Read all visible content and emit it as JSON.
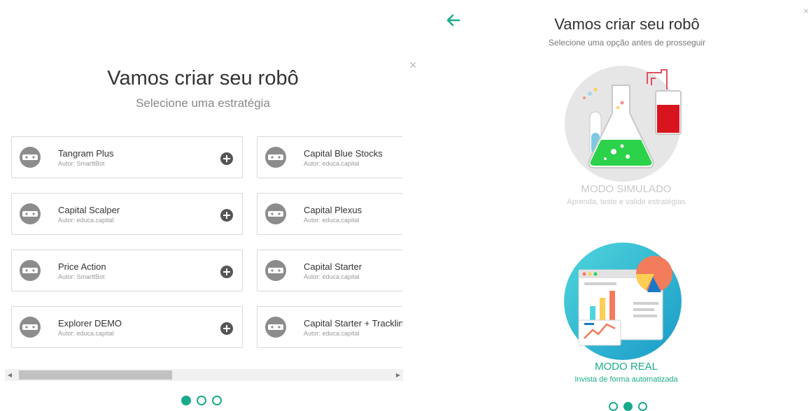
{
  "left": {
    "title": "Vamos criar seu robô",
    "subtitle": "Selecione uma estratégia",
    "close_icon": "×",
    "strategies": [
      {
        "name": "Tangram Plus",
        "author": "Autor: SmarttBot"
      },
      {
        "name": "Capital Blue Stocks",
        "author": "Autor: educa.capital"
      },
      {
        "name": "Capital Scalper",
        "author": "Autor: educa.capital"
      },
      {
        "name": "Capital Plexus",
        "author": "Autor: educa.capital"
      },
      {
        "name": "Price Action",
        "author": "Autor: SmarttBot"
      },
      {
        "name": "Capital Starter",
        "author": "Autor: educa.capital"
      },
      {
        "name": "Explorer DEMO",
        "author": "Autor: educa.capital"
      },
      {
        "name": "Capital Starter + Trackling",
        "author": "Autor: educa.capital"
      }
    ],
    "scroll_left_icon": "◀",
    "scroll_right_icon": "▶",
    "pager": {
      "total": 3,
      "active": 0
    }
  },
  "right": {
    "title": "Vamos criar seu robô",
    "subtitle": "Selecione uma opção antes de prosseguir",
    "close_icon": "×",
    "simulated": {
      "title": "MODO SIMULADO",
      "description": "Aprenda, teste e valide estratégias"
    },
    "real": {
      "title": "MODO REAL",
      "description": "Invista de forma automatizada"
    },
    "pager": {
      "total": 3,
      "active": 1
    }
  },
  "colors": {
    "accent": "#1aab8a",
    "muted": "#c9c9c9",
    "robot": "#8c8c8c"
  }
}
